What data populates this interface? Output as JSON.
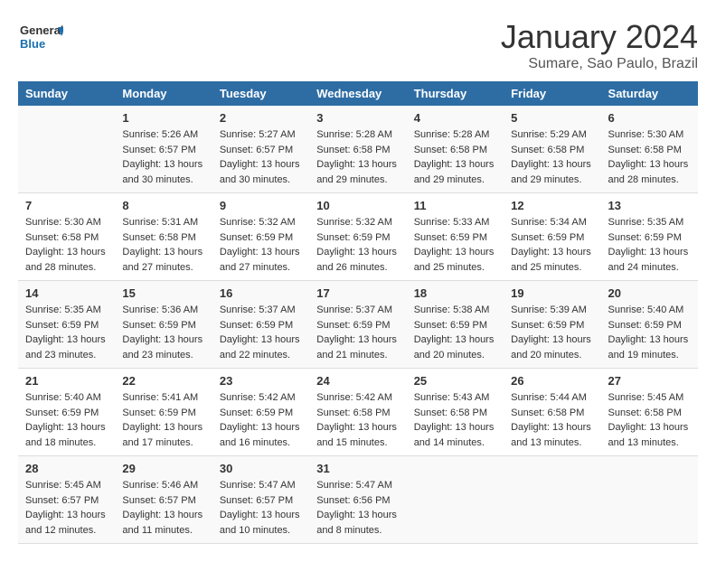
{
  "logo": {
    "text_general": "General",
    "text_blue": "Blue"
  },
  "title": "January 2024",
  "subtitle": "Sumare, Sao Paulo, Brazil",
  "days_of_week": [
    "Sunday",
    "Monday",
    "Tuesday",
    "Wednesday",
    "Thursday",
    "Friday",
    "Saturday"
  ],
  "weeks": [
    [
      {
        "day": "",
        "sunrise": "",
        "sunset": "",
        "daylight": ""
      },
      {
        "day": "1",
        "sunrise": "Sunrise: 5:26 AM",
        "sunset": "Sunset: 6:57 PM",
        "daylight": "Daylight: 13 hours and 30 minutes."
      },
      {
        "day": "2",
        "sunrise": "Sunrise: 5:27 AM",
        "sunset": "Sunset: 6:57 PM",
        "daylight": "Daylight: 13 hours and 30 minutes."
      },
      {
        "day": "3",
        "sunrise": "Sunrise: 5:28 AM",
        "sunset": "Sunset: 6:58 PM",
        "daylight": "Daylight: 13 hours and 29 minutes."
      },
      {
        "day": "4",
        "sunrise": "Sunrise: 5:28 AM",
        "sunset": "Sunset: 6:58 PM",
        "daylight": "Daylight: 13 hours and 29 minutes."
      },
      {
        "day": "5",
        "sunrise": "Sunrise: 5:29 AM",
        "sunset": "Sunset: 6:58 PM",
        "daylight": "Daylight: 13 hours and 29 minutes."
      },
      {
        "day": "6",
        "sunrise": "Sunrise: 5:30 AM",
        "sunset": "Sunset: 6:58 PM",
        "daylight": "Daylight: 13 hours and 28 minutes."
      }
    ],
    [
      {
        "day": "7",
        "sunrise": "Sunrise: 5:30 AM",
        "sunset": "Sunset: 6:58 PM",
        "daylight": "Daylight: 13 hours and 28 minutes."
      },
      {
        "day": "8",
        "sunrise": "Sunrise: 5:31 AM",
        "sunset": "Sunset: 6:58 PM",
        "daylight": "Daylight: 13 hours and 27 minutes."
      },
      {
        "day": "9",
        "sunrise": "Sunrise: 5:32 AM",
        "sunset": "Sunset: 6:59 PM",
        "daylight": "Daylight: 13 hours and 27 minutes."
      },
      {
        "day": "10",
        "sunrise": "Sunrise: 5:32 AM",
        "sunset": "Sunset: 6:59 PM",
        "daylight": "Daylight: 13 hours and 26 minutes."
      },
      {
        "day": "11",
        "sunrise": "Sunrise: 5:33 AM",
        "sunset": "Sunset: 6:59 PM",
        "daylight": "Daylight: 13 hours and 25 minutes."
      },
      {
        "day": "12",
        "sunrise": "Sunrise: 5:34 AM",
        "sunset": "Sunset: 6:59 PM",
        "daylight": "Daylight: 13 hours and 25 minutes."
      },
      {
        "day": "13",
        "sunrise": "Sunrise: 5:35 AM",
        "sunset": "Sunset: 6:59 PM",
        "daylight": "Daylight: 13 hours and 24 minutes."
      }
    ],
    [
      {
        "day": "14",
        "sunrise": "Sunrise: 5:35 AM",
        "sunset": "Sunset: 6:59 PM",
        "daylight": "Daylight: 13 hours and 23 minutes."
      },
      {
        "day": "15",
        "sunrise": "Sunrise: 5:36 AM",
        "sunset": "Sunset: 6:59 PM",
        "daylight": "Daylight: 13 hours and 23 minutes."
      },
      {
        "day": "16",
        "sunrise": "Sunrise: 5:37 AM",
        "sunset": "Sunset: 6:59 PM",
        "daylight": "Daylight: 13 hours and 22 minutes."
      },
      {
        "day": "17",
        "sunrise": "Sunrise: 5:37 AM",
        "sunset": "Sunset: 6:59 PM",
        "daylight": "Daylight: 13 hours and 21 minutes."
      },
      {
        "day": "18",
        "sunrise": "Sunrise: 5:38 AM",
        "sunset": "Sunset: 6:59 PM",
        "daylight": "Daylight: 13 hours and 20 minutes."
      },
      {
        "day": "19",
        "sunrise": "Sunrise: 5:39 AM",
        "sunset": "Sunset: 6:59 PM",
        "daylight": "Daylight: 13 hours and 20 minutes."
      },
      {
        "day": "20",
        "sunrise": "Sunrise: 5:40 AM",
        "sunset": "Sunset: 6:59 PM",
        "daylight": "Daylight: 13 hours and 19 minutes."
      }
    ],
    [
      {
        "day": "21",
        "sunrise": "Sunrise: 5:40 AM",
        "sunset": "Sunset: 6:59 PM",
        "daylight": "Daylight: 13 hours and 18 minutes."
      },
      {
        "day": "22",
        "sunrise": "Sunrise: 5:41 AM",
        "sunset": "Sunset: 6:59 PM",
        "daylight": "Daylight: 13 hours and 17 minutes."
      },
      {
        "day": "23",
        "sunrise": "Sunrise: 5:42 AM",
        "sunset": "Sunset: 6:59 PM",
        "daylight": "Daylight: 13 hours and 16 minutes."
      },
      {
        "day": "24",
        "sunrise": "Sunrise: 5:42 AM",
        "sunset": "Sunset: 6:58 PM",
        "daylight": "Daylight: 13 hours and 15 minutes."
      },
      {
        "day": "25",
        "sunrise": "Sunrise: 5:43 AM",
        "sunset": "Sunset: 6:58 PM",
        "daylight": "Daylight: 13 hours and 14 minutes."
      },
      {
        "day": "26",
        "sunrise": "Sunrise: 5:44 AM",
        "sunset": "Sunset: 6:58 PM",
        "daylight": "Daylight: 13 hours and 13 minutes."
      },
      {
        "day": "27",
        "sunrise": "Sunrise: 5:45 AM",
        "sunset": "Sunset: 6:58 PM",
        "daylight": "Daylight: 13 hours and 13 minutes."
      }
    ],
    [
      {
        "day": "28",
        "sunrise": "Sunrise: 5:45 AM",
        "sunset": "Sunset: 6:57 PM",
        "daylight": "Daylight: 13 hours and 12 minutes."
      },
      {
        "day": "29",
        "sunrise": "Sunrise: 5:46 AM",
        "sunset": "Sunset: 6:57 PM",
        "daylight": "Daylight: 13 hours and 11 minutes."
      },
      {
        "day": "30",
        "sunrise": "Sunrise: 5:47 AM",
        "sunset": "Sunset: 6:57 PM",
        "daylight": "Daylight: 13 hours and 10 minutes."
      },
      {
        "day": "31",
        "sunrise": "Sunrise: 5:47 AM",
        "sunset": "Sunset: 6:56 PM",
        "daylight": "Daylight: 13 hours and 8 minutes."
      },
      {
        "day": "",
        "sunrise": "",
        "sunset": "",
        "daylight": ""
      },
      {
        "day": "",
        "sunrise": "",
        "sunset": "",
        "daylight": ""
      },
      {
        "day": "",
        "sunrise": "",
        "sunset": "",
        "daylight": ""
      }
    ]
  ]
}
